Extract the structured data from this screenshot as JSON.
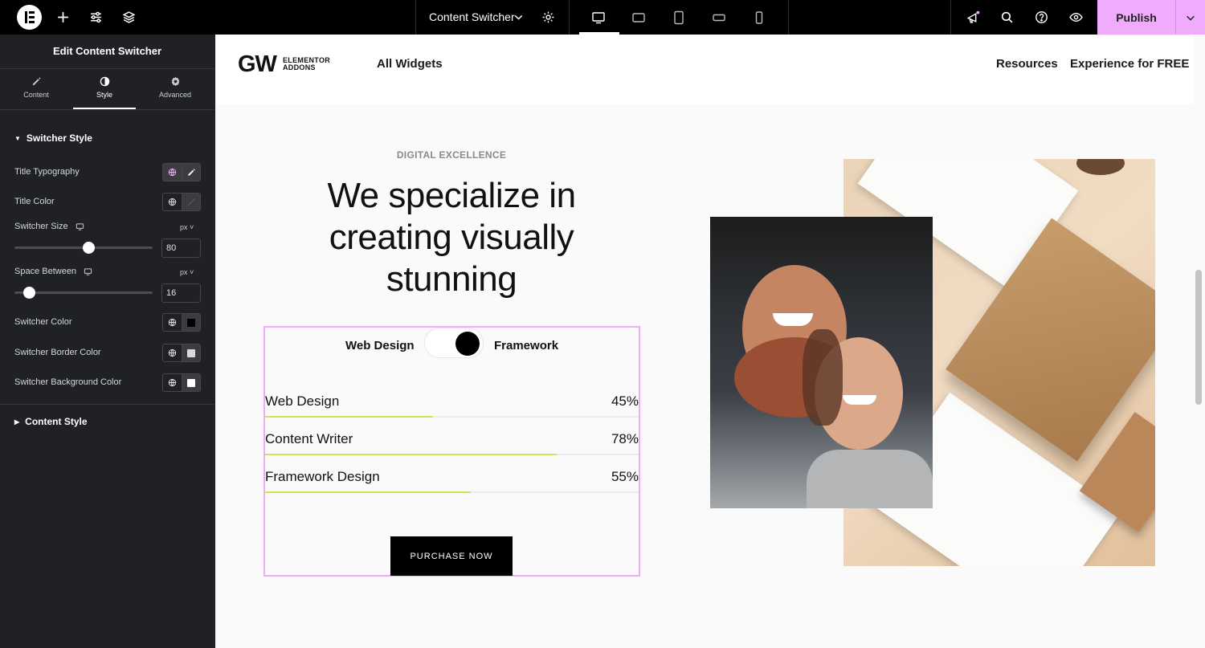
{
  "topbar": {
    "document_title": "Content Switcher",
    "publish_label": "Publish"
  },
  "panel": {
    "title": "Edit Content Switcher",
    "tabs": [
      {
        "label": "Content",
        "icon": "pencil-icon"
      },
      {
        "label": "Style",
        "icon": "half-circle-icon",
        "active": true
      },
      {
        "label": "Advanced",
        "icon": "gear-icon"
      }
    ],
    "switcher_style": {
      "heading": "Switcher Style",
      "title_typography": "Title Typography",
      "title_color": "Title Color",
      "switcher_size": {
        "label": "Switcher Size",
        "unit": "px",
        "value": "80"
      },
      "space_between": {
        "label": "Space Between",
        "unit": "px",
        "value": "16"
      },
      "switcher_color": {
        "label": "Switcher Color",
        "color": "#000000"
      },
      "switcher_border_color": {
        "label": "Switcher Border Color",
        "color": "#d9d9d9"
      },
      "switcher_background_color": {
        "label": "Switcher Background Color",
        "color": "#ffffff"
      }
    },
    "content_style": {
      "heading": "Content Style"
    }
  },
  "site": {
    "brand": {
      "mark": "GW",
      "line1": "ELEMENTOR",
      "line2": "ADDONS"
    },
    "nav": {
      "all_widgets": "All Widgets",
      "resources": "Resources",
      "experience": "Experience for FREE"
    },
    "eyebrow": "DIGITAL EXCELLENCE",
    "heading": "We specialize in creating visually stunning",
    "switcher": {
      "left_label": "Web Design",
      "right_label": "Framework"
    },
    "skills": [
      {
        "name": "Web Design",
        "percent_label": "45%",
        "percent": 45
      },
      {
        "name": "Content Writer",
        "percent_label": "78%",
        "percent": 78
      },
      {
        "name": "Framework Design",
        "percent_label": "55%",
        "percent": 55
      }
    ],
    "cta_label": "PURCHASE NOW"
  },
  "colors": {
    "accent": "#f0abfc",
    "progress": "#d4e157",
    "panel_bg": "#1f2124",
    "topbar_bg": "#000000"
  }
}
